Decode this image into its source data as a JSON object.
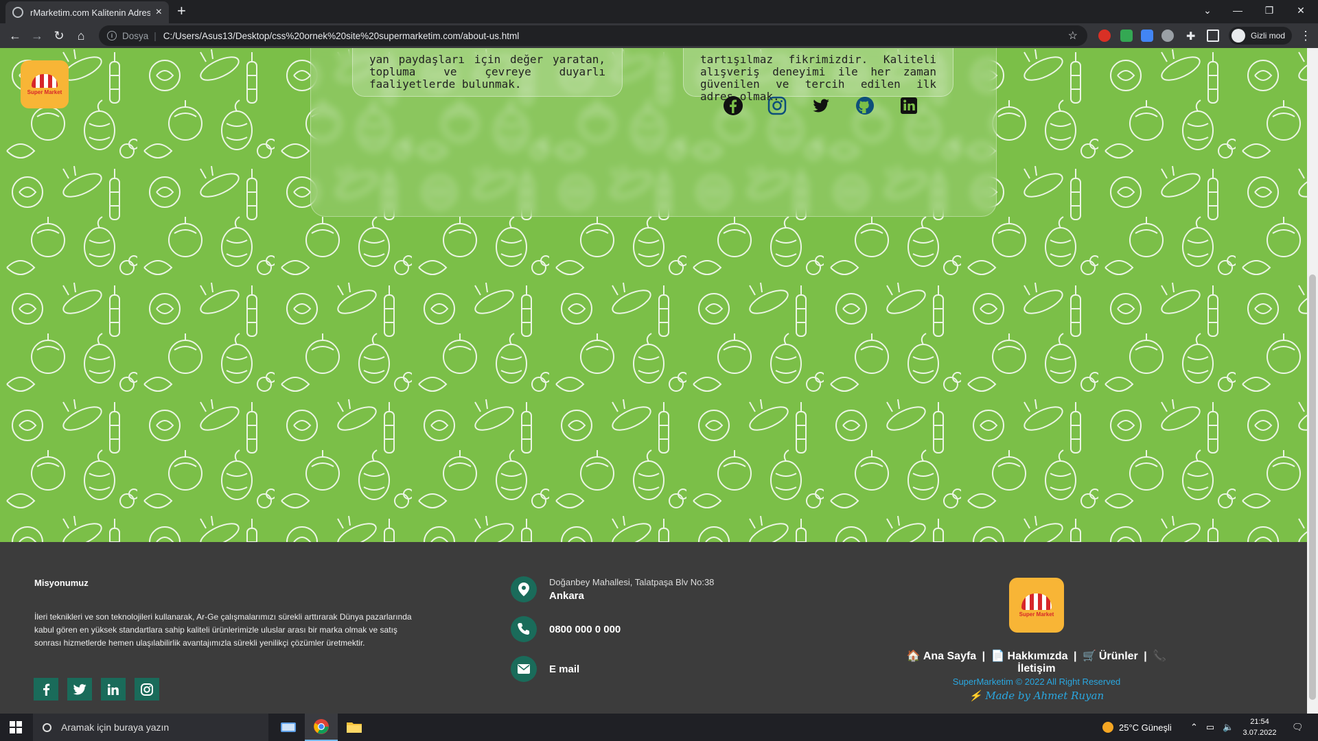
{
  "browser": {
    "tab_title": "rMarketim.com Kalitenin Adresi",
    "tab_close": "×",
    "new_tab": "+",
    "scheme_label": "Dosya",
    "url": "C:/Users/Asus13/Desktop/css%20ornek%20site%20supermarketim.com/about-us.html",
    "profile_label": "Gizli mod"
  },
  "page": {
    "logo_text": "Super Market",
    "card_left": "yan paydaşları için değer yaratan, topluma ve çevreye duyarlı faaliyetlerde bulunmak.",
    "card_right": "tartışılmaz fikrimizdir. Kaliteli alışveriş deneyimi ile her zaman güvenilen ve tercih edilen ilk adres olmak.",
    "social_icons": [
      "facebook-icon",
      "instagram-icon",
      "twitter-icon",
      "github-icon",
      "linkedin-icon"
    ]
  },
  "footer": {
    "mission_title": "Misyonumuz",
    "mission_text": "İleri teknikleri ve son teknolojileri kullanarak, Ar-Ge çalışmalarımızı sürekli arttırarak Dünya pazarlarında kabul gören en yüksek standartlara sahip kaliteli ürünlerimizle uluslar arası bir marka olmak ve satış sonrası hizmetlerde hemen ulaşılabilirlik avantajımızla sürekli yenilikçi çözümler üretmektir.",
    "address_line": "Doğanbey Mahallesi, Talatpaşa Blv No:38",
    "city": "Ankara",
    "phone": "0800 000 0 000",
    "email": "E mail",
    "logo_text": "Super Market",
    "nav": [
      "Ana Sayfa",
      "Hakkımızda",
      "Ürünler",
      "İletişim"
    ],
    "nav_sep": "|",
    "copyright": "SuperMarketim © 2022 All Right Reserved",
    "made_by": "Made by Ahmet Ruyan"
  },
  "taskbar": {
    "search_placeholder": "Aramak için buraya yazın",
    "weather": "25°C  Güneşli",
    "time": "21:54",
    "date": "3.07.2022"
  },
  "colors": {
    "page_green": "#7bbf48",
    "footer_bg": "#3c3c3c",
    "teal": "#1a6b5a",
    "logo_yellow": "#f8b536",
    "link_blue": "#2aa7e0"
  }
}
